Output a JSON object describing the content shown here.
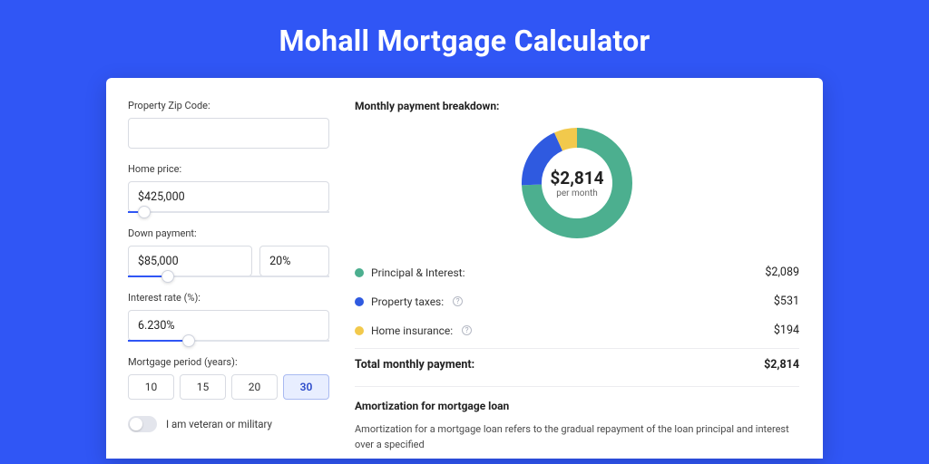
{
  "page": {
    "title": "Mohall Mortgage Calculator"
  },
  "form": {
    "zip_label": "Property Zip Code:",
    "zip_value": "",
    "home_price_label": "Home price:",
    "home_price_value": "$425,000",
    "home_price_slider_pct": 8,
    "down_label": "Down payment:",
    "down_value": "$85,000",
    "down_pct_value": "20%",
    "down_slider_pct": 20,
    "rate_label": "Interest rate (%):",
    "rate_value": "6.230%",
    "rate_slider_pct": 30,
    "period_label": "Mortgage period (years):",
    "periods": [
      "10",
      "15",
      "20",
      "30"
    ],
    "period_selected": "30",
    "veteran_label": "I am veteran or military"
  },
  "breakdown": {
    "title": "Monthly payment breakdown:",
    "center_amount": "$2,814",
    "center_sub": "per month",
    "items": [
      {
        "label": "Principal & Interest:",
        "value": "$2,089",
        "color": "green",
        "info": false
      },
      {
        "label": "Property taxes:",
        "value": "$531",
        "color": "blue",
        "info": true
      },
      {
        "label": "Home insurance:",
        "value": "$194",
        "color": "yellow",
        "info": true
      }
    ],
    "total_label": "Total monthly payment:",
    "total_value": "$2,814"
  },
  "amort": {
    "title": "Amortization for mortgage loan",
    "body": "Amortization for a mortgage loan refers to the gradual repayment of the loan principal and interest over a specified"
  },
  "chart_data": {
    "type": "pie",
    "title": "Monthly payment breakdown",
    "series": [
      {
        "name": "Principal & Interest",
        "value": 2089,
        "color": "#4caf8f"
      },
      {
        "name": "Property taxes",
        "value": 531,
        "color": "#2f5ae0"
      },
      {
        "name": "Home insurance",
        "value": 194,
        "color": "#f2c94c"
      }
    ],
    "total": 2814
  }
}
